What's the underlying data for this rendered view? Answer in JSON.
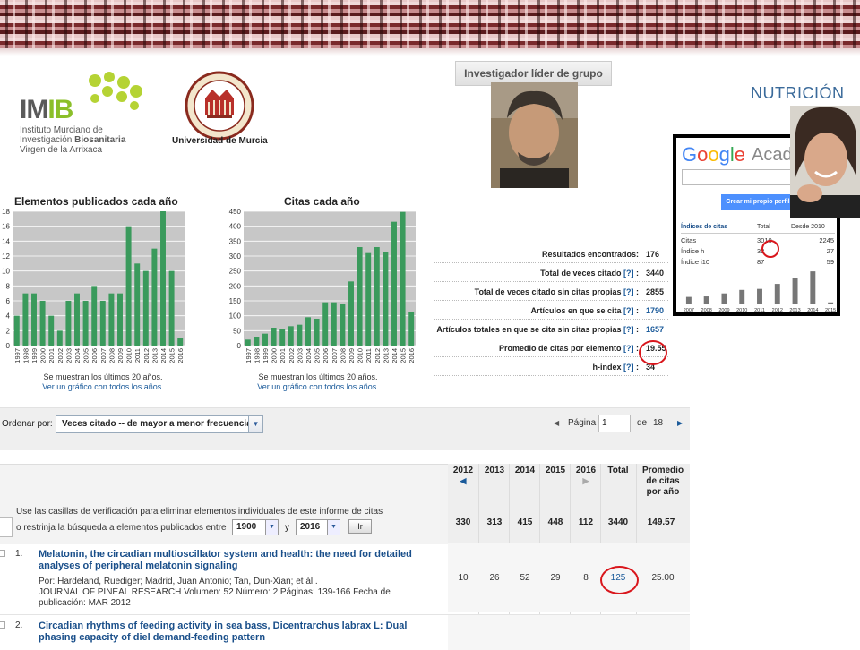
{
  "header": {
    "imib": {
      "abbr_start": "IM",
      "abbr_end": "IB",
      "line1": "Instituto Murciano de",
      "line2a": "Investigación ",
      "line2b": "Biosanitaria",
      "line3": "Virgen de la Arrixaca"
    },
    "um": {
      "name": "Universidad de Murcia"
    },
    "researcher_label": "Investigador líder de grupo",
    "area_label": "NUTRICIÓN"
  },
  "scholar": {
    "logo": "Google",
    "logo_colors": [
      "#4285f4",
      "#ea4335",
      "#fbbc05",
      "#4285f4",
      "#34a853",
      "#ea4335"
    ],
    "academico": "Acadé",
    "button": "Crear mi propio perfil",
    "table_headers": {
      "label": "Índices de citas",
      "all": "Total",
      "since": "Desde 2010"
    },
    "rows": [
      {
        "label": "Citas",
        "all": "3010",
        "since": "2245"
      },
      {
        "label": "Índice h",
        "all": "32",
        "since": "27"
      },
      {
        "label": "Índice i10",
        "all": "87",
        "since": "59"
      }
    ],
    "chart": {
      "years": [
        "2007",
        "2008",
        "2009",
        "2010",
        "2011",
        "2012",
        "2013",
        "2014",
        "2015"
      ],
      "values": [
        75,
        80,
        110,
        145,
        155,
        205,
        260,
        330,
        20
      ]
    }
  },
  "chart_data": [
    {
      "type": "bar",
      "title": "Elementos publicados cada año",
      "categories": [
        "1997",
        "1998",
        "1999",
        "2000",
        "2001",
        "2002",
        "2003",
        "2004",
        "2005",
        "2006",
        "2007",
        "2008",
        "2009",
        "2010",
        "2011",
        "2012",
        "2013",
        "2014",
        "2015",
        "2016"
      ],
      "values": [
        4,
        7,
        7,
        6,
        4,
        2,
        6,
        7,
        6,
        8,
        6,
        7,
        7,
        16,
        11,
        10,
        13,
        18,
        10,
        1
      ],
      "ylim": [
        0,
        18
      ],
      "yticks": [
        0,
        2,
        4,
        6,
        8,
        10,
        12,
        14,
        16,
        18
      ],
      "color": "#3a9a5c",
      "note": "Se muestran los últimos 20 años.",
      "link": "Ver un gráfico con todos los años."
    },
    {
      "type": "bar",
      "title": "Citas cada año",
      "categories": [
        "1997",
        "1998",
        "1999",
        "2000",
        "2001",
        "2002",
        "2003",
        "2004",
        "2005",
        "2006",
        "2007",
        "2008",
        "2009",
        "2010",
        "2011",
        "2012",
        "2013",
        "2014",
        "2015",
        "2016"
      ],
      "values": [
        20,
        30,
        40,
        60,
        55,
        65,
        70,
        95,
        90,
        145,
        145,
        140,
        215,
        330,
        310,
        330,
        313,
        415,
        448,
        112
      ],
      "ylim": [
        0,
        450
      ],
      "yticks": [
        0,
        50,
        100,
        150,
        200,
        250,
        300,
        350,
        400,
        450
      ],
      "color": "#3a9a5c",
      "note": "Se muestran los últimos 20 años.",
      "link": "Ver un gráfico con todos los años."
    }
  ],
  "stats": [
    {
      "label": "Resultados encontrados:",
      "help": "",
      "value": "176",
      "blue": false
    },
    {
      "label": "Total de veces citado ",
      "help": "[?]",
      "value": "3440",
      "blue": false
    },
    {
      "label": "Total de veces citado sin citas propias ",
      "help": "[?]",
      "value": "2855",
      "blue": false
    },
    {
      "label": "Artículos en que se cita ",
      "help": "[?]",
      "value": "1790",
      "blue": true
    },
    {
      "label": "Artículos totales en que se cita sin citas propias ",
      "help": "[?]",
      "value": "1657",
      "blue": true
    },
    {
      "label": "Promedio de citas por elemento ",
      "help": "[?]",
      "value": "19.55",
      "blue": false
    },
    {
      "label": "h-index ",
      "help": "[?]",
      "value": "34",
      "blue": false
    }
  ],
  "sort": {
    "label": "Ordenar por:",
    "value": "Veces citado -- de mayor a menor frecuencia"
  },
  "pager": {
    "label": "Página",
    "current": "1",
    "of": "de",
    "total": "18"
  },
  "results": {
    "years": [
      "2012",
      "2013",
      "2014",
      "2015",
      "2016"
    ],
    "total_header": "Total",
    "avg_header_1": "Promedio",
    "avg_header_2": "de citas",
    "avg_header_3": "por año",
    "totals": [
      "330",
      "313",
      "415",
      "448",
      "112",
      "3440",
      "149.57"
    ],
    "filter_line1": "Use las casillas de verificación para eliminar elementos individuales de este informe de citas",
    "filter_line2": "o restrinja la búsqueda a elementos publicados entre",
    "from_year": "1900",
    "and": "y",
    "to_year": "2016",
    "go": "Ir"
  },
  "records": [
    {
      "num": "1.",
      "title": "Melatonin, the circadian multioscillator system and health: the need for detailed analyses of peripheral melatonin signaling",
      "authors": "Por: Hardeland, Ruediger; Madrid, Juan Antonio; Tan, Dun-Xian; et ál..",
      "source": "JOURNAL OF PINEAL RESEARCH  Volumen: 52  Número: 2  Páginas: 139-166  Fecha de publicación: MAR 2012",
      "cites": [
        "10",
        "26",
        "52",
        "29",
        "8"
      ],
      "total": "125",
      "avg": "25.00"
    },
    {
      "num": "2.",
      "title": "Circadian rhythms of feeding activity in sea bass, Dicentrarchus labrax L: Dual phasing capacity of diel demand-feeding pattern",
      "authors": "",
      "source": "",
      "cites": [],
      "total": "",
      "avg": ""
    }
  ]
}
